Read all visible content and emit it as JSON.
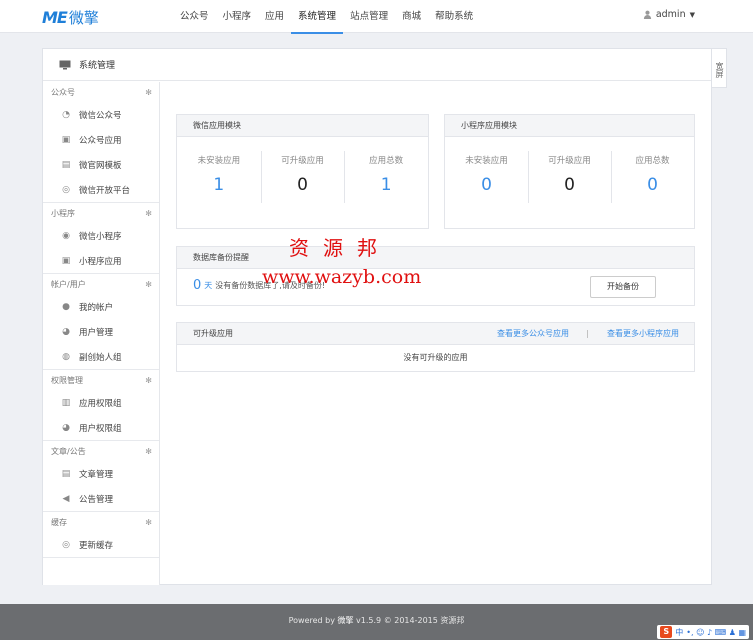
{
  "brand": {
    "mark": "ME",
    "name": "微擎"
  },
  "nav": [
    {
      "label": "公众号",
      "active": false
    },
    {
      "label": "小程序",
      "active": false
    },
    {
      "label": "应用",
      "active": false
    },
    {
      "label": "系统管理",
      "active": true
    },
    {
      "label": "站点管理",
      "active": false
    },
    {
      "label": "商城",
      "active": false
    },
    {
      "label": "帮助系统",
      "active": false
    }
  ],
  "user": {
    "name": "admin"
  },
  "panel": {
    "title": "系统管理",
    "wide_button": "宽屏"
  },
  "sidebar": [
    {
      "title": "公众号",
      "items": [
        {
          "label": "微信公众号",
          "icon": "wechat-icon"
        },
        {
          "label": "公众号应用",
          "icon": "app-icon"
        },
        {
          "label": "微官网模板",
          "icon": "template-icon"
        },
        {
          "label": "微信开放平台",
          "icon": "open-platform-icon"
        }
      ]
    },
    {
      "title": "小程序",
      "items": [
        {
          "label": "微信小程序",
          "icon": "mini-program-icon"
        },
        {
          "label": "小程序应用",
          "icon": "app-icon"
        }
      ]
    },
    {
      "title": "帐户/用户",
      "items": [
        {
          "label": "我的帐户",
          "icon": "user-icon"
        },
        {
          "label": "用户管理",
          "icon": "users-icon"
        },
        {
          "label": "副创始人组",
          "icon": "user-group-icon"
        }
      ]
    },
    {
      "title": "权限管理",
      "items": [
        {
          "label": "应用权限组",
          "icon": "lock-icon"
        },
        {
          "label": "用户权限组",
          "icon": "users-icon"
        }
      ]
    },
    {
      "title": "文章/公告",
      "items": [
        {
          "label": "文章管理",
          "icon": "article-icon"
        },
        {
          "label": "公告管理",
          "icon": "speaker-icon"
        }
      ]
    },
    {
      "title": "缓存",
      "items": [
        {
          "label": "更新缓存",
          "icon": "refresh-icon"
        }
      ]
    }
  ],
  "wechat_card": {
    "title": "微信应用模块",
    "stats": [
      {
        "label": "未安装应用",
        "value": "1"
      },
      {
        "label": "可升级应用",
        "value": "0"
      },
      {
        "label": "应用总数",
        "value": "1"
      }
    ]
  },
  "mini_card": {
    "title": "小程序应用模块",
    "stats": [
      {
        "label": "未安装应用",
        "value": "0"
      },
      {
        "label": "可升级应用",
        "value": "0"
      },
      {
        "label": "应用总数",
        "value": "0"
      }
    ]
  },
  "backup": {
    "title": "数据库备份提醒",
    "days": "0",
    "unit": "天",
    "message": "没有备份数据库了,请及时备份!",
    "button": "开始备份"
  },
  "upgrade": {
    "title": "可升级应用",
    "link1": "查看更多公众号应用",
    "separator": "|",
    "link2": "查看更多小程序应用",
    "empty": "没有可升级的应用"
  },
  "watermark": {
    "line1": "资源邦",
    "line2": "www.wazyb.com"
  },
  "footer": {
    "prefix": "Powered by ",
    "brand": "微擎",
    "suffix": " v1.5.9 © 2014-2015 资源邦"
  },
  "ime": {
    "logo": "S",
    "lang": "中",
    "extra": "•, ☺ ♪ ⌨ ♟ ▦"
  },
  "colors": {
    "accent": "#3a8ee6",
    "watermark": "#e01010",
    "footer_bg": "#6b6d70"
  }
}
